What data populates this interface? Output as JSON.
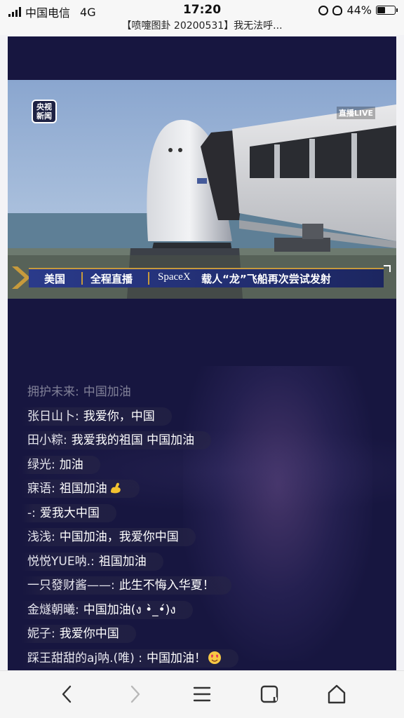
{
  "status_bar": {
    "carrier": "中国电信",
    "network": "4G",
    "time": "17:20",
    "battery": "44%",
    "battery_level": 0.44
  },
  "browser": {
    "page_title": "【喷嚏图卦 20200531】我无法呼..."
  },
  "video": {
    "channel_logo": "央视新闻",
    "live_tag": "直播LIVE",
    "banner_country": "美国",
    "banner_type": "全程直播",
    "banner_brand": "SpaceX",
    "banner_headline": "载人“龙”飞船再次尝试发射"
  },
  "comments": [
    {
      "user": "拥护未来",
      "sep": ":",
      "text": "中国加油",
      "faded": true
    },
    {
      "user": "张日山卜",
      "sep": ":",
      "text": "我爱你，中国"
    },
    {
      "user": "田小粽",
      "sep": ":",
      "text": "我爱我的祖国 中国加油"
    },
    {
      "user": "绿光",
      "sep": ":",
      "text": "加油"
    },
    {
      "user": "寐语",
      "sep": ":",
      "text": "祖国加油",
      "emoji": "muscle"
    },
    {
      "user": "-",
      "sep": ":",
      "text": "爱我大中国"
    },
    {
      "user": "浅浅",
      "sep": ":",
      "text": "中国加油，我爱你中国"
    },
    {
      "user": "悦悦YUE呐.",
      "sep": ":",
      "text": "祖国加油"
    },
    {
      "user": "一只發财酱——",
      "sep": ":",
      "text": "此生不悔入华夏！"
    },
    {
      "user": "金燧朝曦",
      "sep": ":",
      "text": "中国加油(ง •̀_•́)ง"
    },
    {
      "user": "妮子",
      "sep": ":",
      "text": "我爱你中国"
    },
    {
      "user": "踩王甜甜的aj呐.(唯)",
      "sep": " :",
      "text": "中国加油！",
      "emoji": "heart-face"
    }
  ],
  "nav": {
    "icons": [
      "back-icon",
      "forward-icon",
      "menu-icon",
      "tabs-icon",
      "home-icon"
    ]
  },
  "colors": {
    "live_bg": "#171640",
    "banner_gold": "#c79a3c",
    "banner_blue": "#2a3a8a"
  }
}
